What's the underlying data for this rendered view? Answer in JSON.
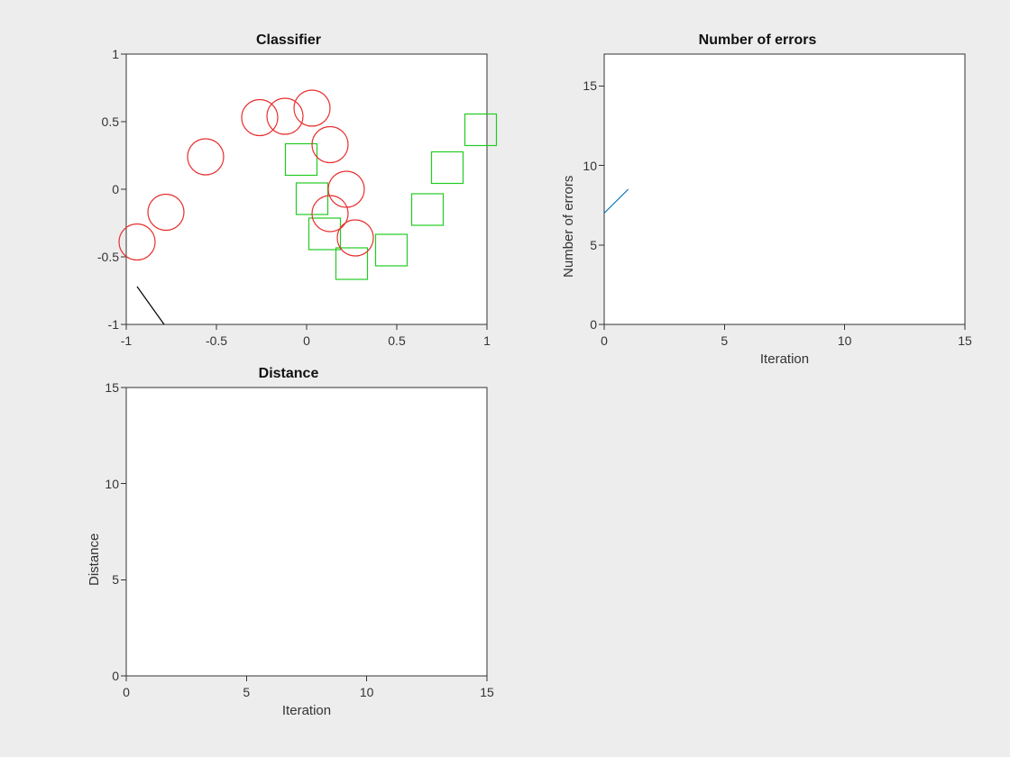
{
  "chart_data": [
    {
      "type": "scatter",
      "title": "Classifier",
      "xlim": [
        -1,
        1
      ],
      "ylim": [
        -1,
        1
      ],
      "xticks": [
        -1,
        -0.5,
        0,
        0.5,
        1
      ],
      "yticks": [
        -1,
        -0.5,
        0,
        0.5,
        1
      ],
      "series": [
        {
          "name": "red-circles",
          "marker": "o",
          "color": "#E82E2E",
          "points": [
            {
              "x": -0.94,
              "y": -0.39
            },
            {
              "x": -0.78,
              "y": -0.17
            },
            {
              "x": -0.56,
              "y": 0.24
            },
            {
              "x": -0.26,
              "y": 0.53
            },
            {
              "x": -0.12,
              "y": 0.54
            },
            {
              "x": 0.03,
              "y": 0.6
            },
            {
              "x": 0.13,
              "y": 0.33
            },
            {
              "x": 0.22,
              "y": 0.0
            },
            {
              "x": 0.13,
              "y": -0.18
            },
            {
              "x": 0.27,
              "y": -0.36
            }
          ]
        },
        {
          "name": "green-squares",
          "marker": "s",
          "color": "#22CC22",
          "points": [
            {
              "x": -0.03,
              "y": 0.22
            },
            {
              "x": 0.03,
              "y": -0.07
            },
            {
              "x": 0.1,
              "y": -0.33
            },
            {
              "x": 0.25,
              "y": -0.55
            },
            {
              "x": 0.47,
              "y": -0.45
            },
            {
              "x": 0.67,
              "y": -0.15
            },
            {
              "x": 0.78,
              "y": 0.16
            },
            {
              "x": 0.965,
              "y": 0.44
            }
          ]
        },
        {
          "name": "boundary",
          "type": "line",
          "color": "#000000",
          "points": [
            {
              "x": -0.94,
              "y": -0.72
            },
            {
              "x": -0.79,
              "y": -1.0
            }
          ]
        }
      ]
    },
    {
      "type": "line",
      "title": "Number of errors",
      "xlabel": "Iteration",
      "ylabel": "Number of errors",
      "xlim": [
        0,
        15
      ],
      "ylim": [
        0,
        17
      ],
      "xticks": [
        0,
        5,
        10,
        15
      ],
      "yticks": [
        0,
        5,
        10,
        15
      ],
      "series": [
        {
          "name": "errors",
          "x": [
            0,
            1
          ],
          "y": [
            7,
            8.5
          ]
        }
      ]
    },
    {
      "type": "line",
      "title": "Distance",
      "xlabel": "Iteration",
      "ylabel": "Distance",
      "xlim": [
        0,
        15
      ],
      "ylim": [
        0,
        15
      ],
      "xticks": [
        0,
        5,
        10,
        15
      ],
      "yticks": [
        0,
        5,
        10,
        15
      ],
      "series": []
    }
  ],
  "labels": {
    "t0": "Classifier",
    "t1": "Number of errors",
    "t2": "Distance",
    "iter": "Iteration",
    "nerr": "Number of errors",
    "dist": "Distance",
    "xc": {
      "m1": "-1",
      "m05": "-0.5",
      "z": "0",
      "p05": "0.5",
      "p1": "1"
    },
    "xe": {
      "a": "0",
      "b": "5",
      "c": "10",
      "d": "15"
    },
    "ye": {
      "a": "0",
      "b": "5",
      "c": "10",
      "d": "15"
    }
  }
}
